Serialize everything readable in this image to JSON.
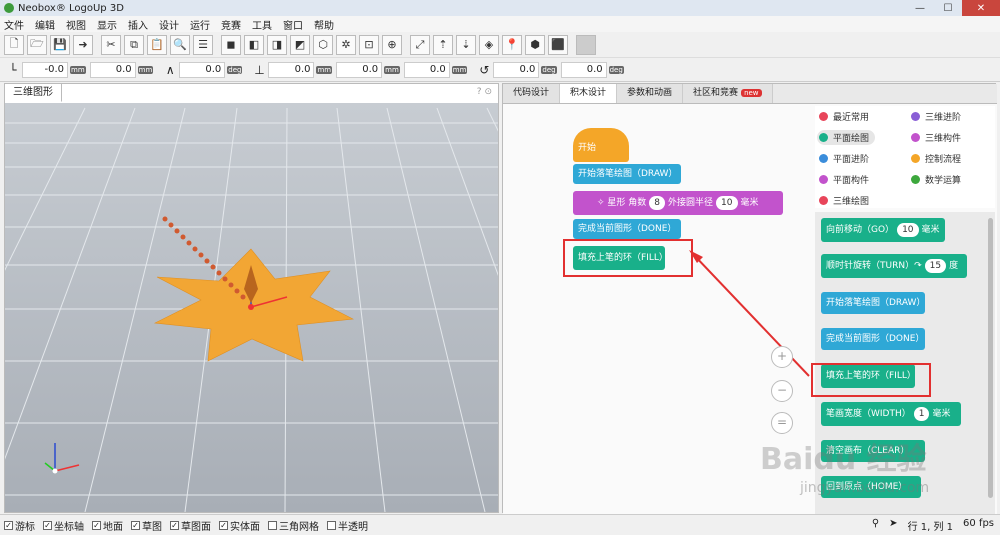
{
  "window": {
    "title": "Neobox® LogoUp 3D"
  },
  "menu": [
    "文件",
    "编辑",
    "视图",
    "显示",
    "插入",
    "设计",
    "运行",
    "竞赛",
    "工具",
    "窗口",
    "帮助"
  ],
  "coords": {
    "group1": [
      {
        "value": "-0.0",
        "unit": "mm"
      },
      {
        "value": "0.0",
        "unit": "mm"
      }
    ],
    "group2": [
      {
        "value": "0.0",
        "unit": "deg"
      }
    ],
    "group3": [
      {
        "value": "0.0",
        "unit": "mm"
      },
      {
        "value": "0.0",
        "unit": "mm"
      },
      {
        "value": "0.0",
        "unit": "mm"
      }
    ],
    "group4": [
      {
        "value": "0.0",
        "unit": "deg"
      },
      {
        "value": "0.0",
        "unit": "deg"
      }
    ]
  },
  "left_panel": {
    "tab": "三维图形",
    "help": "?",
    "pin": "⊙"
  },
  "right_tabs": [
    {
      "label": "代码设计",
      "active": false
    },
    {
      "label": "积木设计",
      "active": true
    },
    {
      "label": "参数和动画",
      "active": false
    },
    {
      "label": "社区和竞赛",
      "active": false,
      "badge": "new"
    }
  ],
  "program": {
    "start": "开始",
    "draw": "开始落笔绘图（DRAW）",
    "star": {
      "label1": "星形 角数",
      "points": "8",
      "label2": "外接圆半径",
      "radius": "10",
      "unit": "毫米"
    },
    "done": "完成当前图形（DONE）",
    "fill": "填充上笔的环（FILL）"
  },
  "categories": [
    {
      "label": "最近常用",
      "color": "#e8455a"
    },
    {
      "label": "三维进阶",
      "color": "#8a5fd6"
    },
    {
      "label": "平面绘图",
      "color": "#19b08a",
      "selected": true
    },
    {
      "label": "三维构件",
      "color": "#c253cc"
    },
    {
      "label": "平面进阶",
      "color": "#3b8ddb"
    },
    {
      "label": "控制流程",
      "color": "#f4a628"
    },
    {
      "label": "平面构件",
      "color": "#c253cc"
    },
    {
      "label": "数学运算",
      "color": "#3da83d"
    },
    {
      "label": "三维绘图",
      "color": "#e8455a"
    }
  ],
  "flyout": {
    "go": {
      "label": "向前移动（GO）",
      "value": "10",
      "unit": "毫米"
    },
    "turn": {
      "label": "顺时针旋转（TURN）",
      "value": "15",
      "unit": "度"
    },
    "draw": "开始落笔绘图（DRAW）",
    "done": "完成当前图形（DONE）",
    "fill": "填充上笔的环（FILL）",
    "width": {
      "label": "笔画宽度（WIDTH）",
      "value": "1",
      "unit": "毫米"
    },
    "clear": "清空画布（CLEAR）",
    "home": "回到原点（HOME）"
  },
  "zoom": {
    "in": "+",
    "out": "−",
    "reset": "="
  },
  "statusbar": {
    "checks": [
      {
        "label": "游标",
        "checked": true
      },
      {
        "label": "坐标轴",
        "checked": true
      },
      {
        "label": "地面",
        "checked": true
      },
      {
        "label": "草图",
        "checked": true
      },
      {
        "label": "草图面",
        "checked": true
      },
      {
        "label": "实体面",
        "checked": true
      },
      {
        "label": "三角网格",
        "checked": false
      },
      {
        "label": "半透明",
        "checked": false
      }
    ],
    "position": "行 1, 列 1",
    "fps": "60 fps"
  },
  "watermark": {
    "brand": "Baidu 经验",
    "url": "jingyan.baidu.com"
  },
  "colors": {
    "star_fill": "#f2a634",
    "grid_bg": "#b9bec6",
    "accent_red": "#e23030"
  }
}
